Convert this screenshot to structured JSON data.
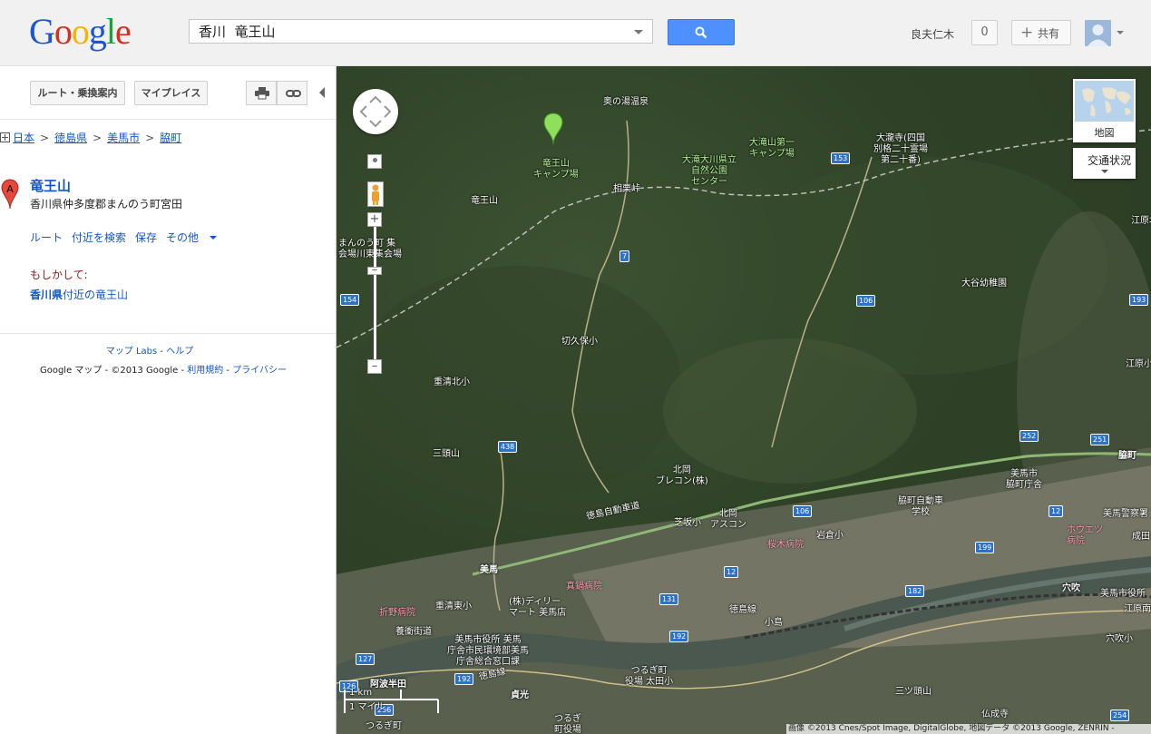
{
  "header": {
    "logo": [
      "G",
      "o",
      "o",
      "g",
      "l",
      "e"
    ],
    "search_value": "香川  竜王山",
    "user_name": "良夫仁木",
    "notification_count": "0",
    "share_label": "共有"
  },
  "panel": {
    "directions_button": "ルート・乗換案内",
    "my_places_button": "マイプレイス",
    "breadcrumb": [
      "日本",
      "徳島県",
      "美馬市",
      "脇町"
    ],
    "result": {
      "marker": "A",
      "title": "竜王山",
      "address": "香川県仲多度郡まんのう町宮田",
      "actions": [
        "ルート",
        "付近を検索",
        "保存",
        "その他"
      ]
    },
    "did_you_mean_label": "もしかして:",
    "suggestion_bold": "香川県",
    "suggestion_rest": "付近の竜王山",
    "footer_links1": [
      "マップ Labs",
      "ヘルプ"
    ],
    "footer_text_prefix": "Google マップ - ©2013 Google - ",
    "footer_links2": [
      "利用規約",
      "プライバシー"
    ],
    "separators": [
      " - ",
      " - "
    ]
  },
  "map": {
    "map_type_label": "地図",
    "traffic_label": "交通状況",
    "scale_km": "1 km",
    "scale_mi": "1 マイル",
    "attribution": "画像 ©2013 Cnes/Spot Image, DigitalGlobe, 地図データ ©2013 Google, ZENRIN -",
    "labels_white": [
      {
        "text": "奥の湯温泉"
      },
      {
        "text": "相栗峠"
      },
      {
        "text": "大瀧寺(四国\n別格二十霊場\n第二十番)"
      },
      {
        "text": "竜王山"
      },
      {
        "text": "まんのう町 集\n会場川東集会場"
      },
      {
        "text": "切久保小"
      },
      {
        "text": "大谷幼稚園"
      },
      {
        "text": "江原北小"
      },
      {
        "text": "重清北小"
      },
      {
        "text": "三頭山"
      },
      {
        "text": "北岡\nブレコン(株)"
      },
      {
        "text": "徳島自動車道"
      },
      {
        "text": "芝坂小"
      },
      {
        "text": "北岡\nアスコン"
      },
      {
        "text": "岩倉小"
      },
      {
        "text": "脇町自動車\n学校"
      },
      {
        "text": "美馬市\n脇町庁舎"
      },
      {
        "text": "美馬警察署"
      },
      {
        "text": "江原小"
      },
      {
        "text": "成田"
      },
      {
        "text": "重清東小"
      },
      {
        "text": "(株)ディリー\nマート 美馬店"
      },
      {
        "text": "徳島線"
      },
      {
        "text": "小島"
      },
      {
        "text": "穴吹"
      },
      {
        "text": "美馬市役所"
      },
      {
        "text": "美馬市役所 美馬\n庁舎市民環境部美馬\n庁舎総合窓口課"
      },
      {
        "text": "養衝街道"
      },
      {
        "text": "徳島線"
      },
      {
        "text": "阿波半田"
      },
      {
        "text": "貞光"
      },
      {
        "text": "つるぎ町\n役場 太田小"
      },
      {
        "text": "つるぎ\n町役場"
      },
      {
        "text": "三ツ頭山"
      },
      {
        "text": "仏成寺"
      },
      {
        "text": "穴吹小"
      },
      {
        "text": "美馬"
      },
      {
        "text": "脇町"
      },
      {
        "text": "江原南"
      },
      {
        "text": "つるぎ町"
      }
    ],
    "labels_green": [
      {
        "text": "竜王山\nキャンプ場"
      },
      {
        "text": "大滝山第一\nキャンプ場"
      },
      {
        "text": "大滝大川県立\n自然公園\nセンター"
      }
    ],
    "labels_pink": [
      {
        "text": "真鍋病院"
      },
      {
        "text": "桜木病院"
      },
      {
        "text": "ホウエツ\n病院"
      },
      {
        "text": "折野病院"
      }
    ],
    "route_shields": [
      "153",
      "7",
      "106",
      "154",
      "193",
      "438",
      "252",
      "251",
      "106",
      "12",
      "199",
      "12",
      "182",
      "131",
      "192",
      "192",
      "127",
      "126",
      "256",
      "254"
    ]
  }
}
